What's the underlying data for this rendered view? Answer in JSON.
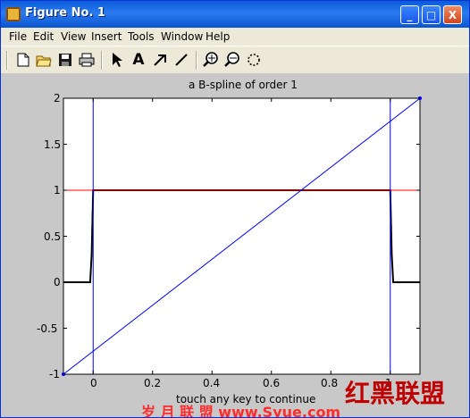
{
  "window": {
    "title": "Figure No. 1",
    "buttons": [
      "_",
      "□",
      "X"
    ]
  },
  "menu": [
    "File",
    "Edit",
    "View",
    "Insert",
    "Tools",
    "Window",
    "Help"
  ],
  "toolbar": {
    "tools": [
      "new-file-icon",
      "open-icon",
      "save-icon",
      "print-icon",
      "pointer-icon",
      "text-icon",
      "arrow-icon",
      "line-icon",
      "zoom-in-icon",
      "zoom-out-icon",
      "rotate-icon"
    ],
    "text_glyph": "A"
  },
  "chart_data": {
    "type": "line",
    "title": "a B-spline of order 1",
    "xlabel": "touch any key to continue",
    "ylabel": "",
    "xlim": [
      -0.1,
      1.1
    ],
    "ylim": [
      -1,
      2
    ],
    "xticks": [
      "0",
      "0.2",
      "0.4",
      "0.6",
      "0.8",
      "1"
    ],
    "yticks": [
      "-1",
      "-0.5",
      "0",
      "0.5",
      "1",
      "1.5",
      "2"
    ],
    "series": [
      {
        "color": "#000000",
        "x": [
          -0.1,
          -0.01,
          -0.005,
          0,
          1,
          1.005,
          1.01,
          1.1
        ],
        "y": [
          0,
          0,
          0.3,
          1,
          1,
          0.3,
          0,
          0
        ]
      },
      {
        "color": "#ff0000",
        "x": [
          -0.1,
          1.1
        ],
        "y": [
          1,
          1
        ]
      },
      {
        "color": "#0000ff",
        "x": [
          -0.1,
          1.1
        ],
        "y": [
          -1,
          2
        ]
      },
      {
        "color": "#0000ff",
        "x": [
          0,
          0
        ],
        "y": [
          -1,
          2
        ]
      },
      {
        "color": "#0000ff",
        "x": [
          1,
          1
        ],
        "y": [
          -1,
          2
        ]
      }
    ]
  },
  "watermark": {
    "left": "岁 月 联 盟  www.Syue.com",
    "right": "红黑联盟"
  },
  "colors": {
    "titlebar": "#0a5bd8",
    "axes_bg": "#ffffff",
    "figure_bg": "#c8c8c8"
  }
}
